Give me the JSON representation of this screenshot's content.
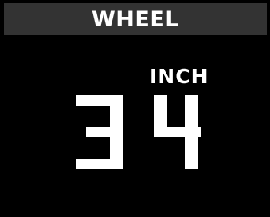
{
  "header": {
    "title": "WHEEL"
  },
  "setting": {
    "unit": "INCH",
    "value": "34"
  },
  "colors": {
    "background": "#000000",
    "header_background": "#333333",
    "foreground": "#ffffff"
  }
}
